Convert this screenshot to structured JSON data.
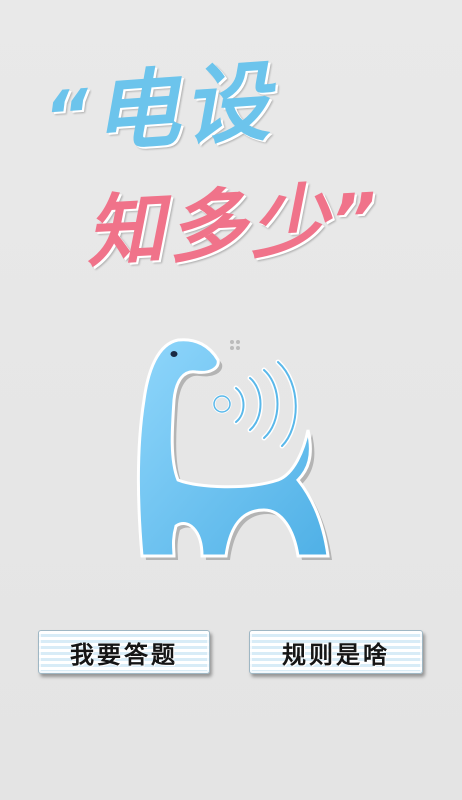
{
  "title": {
    "open_quote": "“",
    "line1": "电设",
    "line2": "知多少",
    "close_quote": "”"
  },
  "menu": {
    "answer_label": "我要答题",
    "rules_label": "规则是啥"
  },
  "colors": {
    "title_blue": "#6cc4ec",
    "title_pink": "#f0738a",
    "mascot_blue": "#6fc3f0",
    "background": "#e6e6e6"
  },
  "icons": {
    "mascot": "dinosaur-speaker-logo"
  }
}
